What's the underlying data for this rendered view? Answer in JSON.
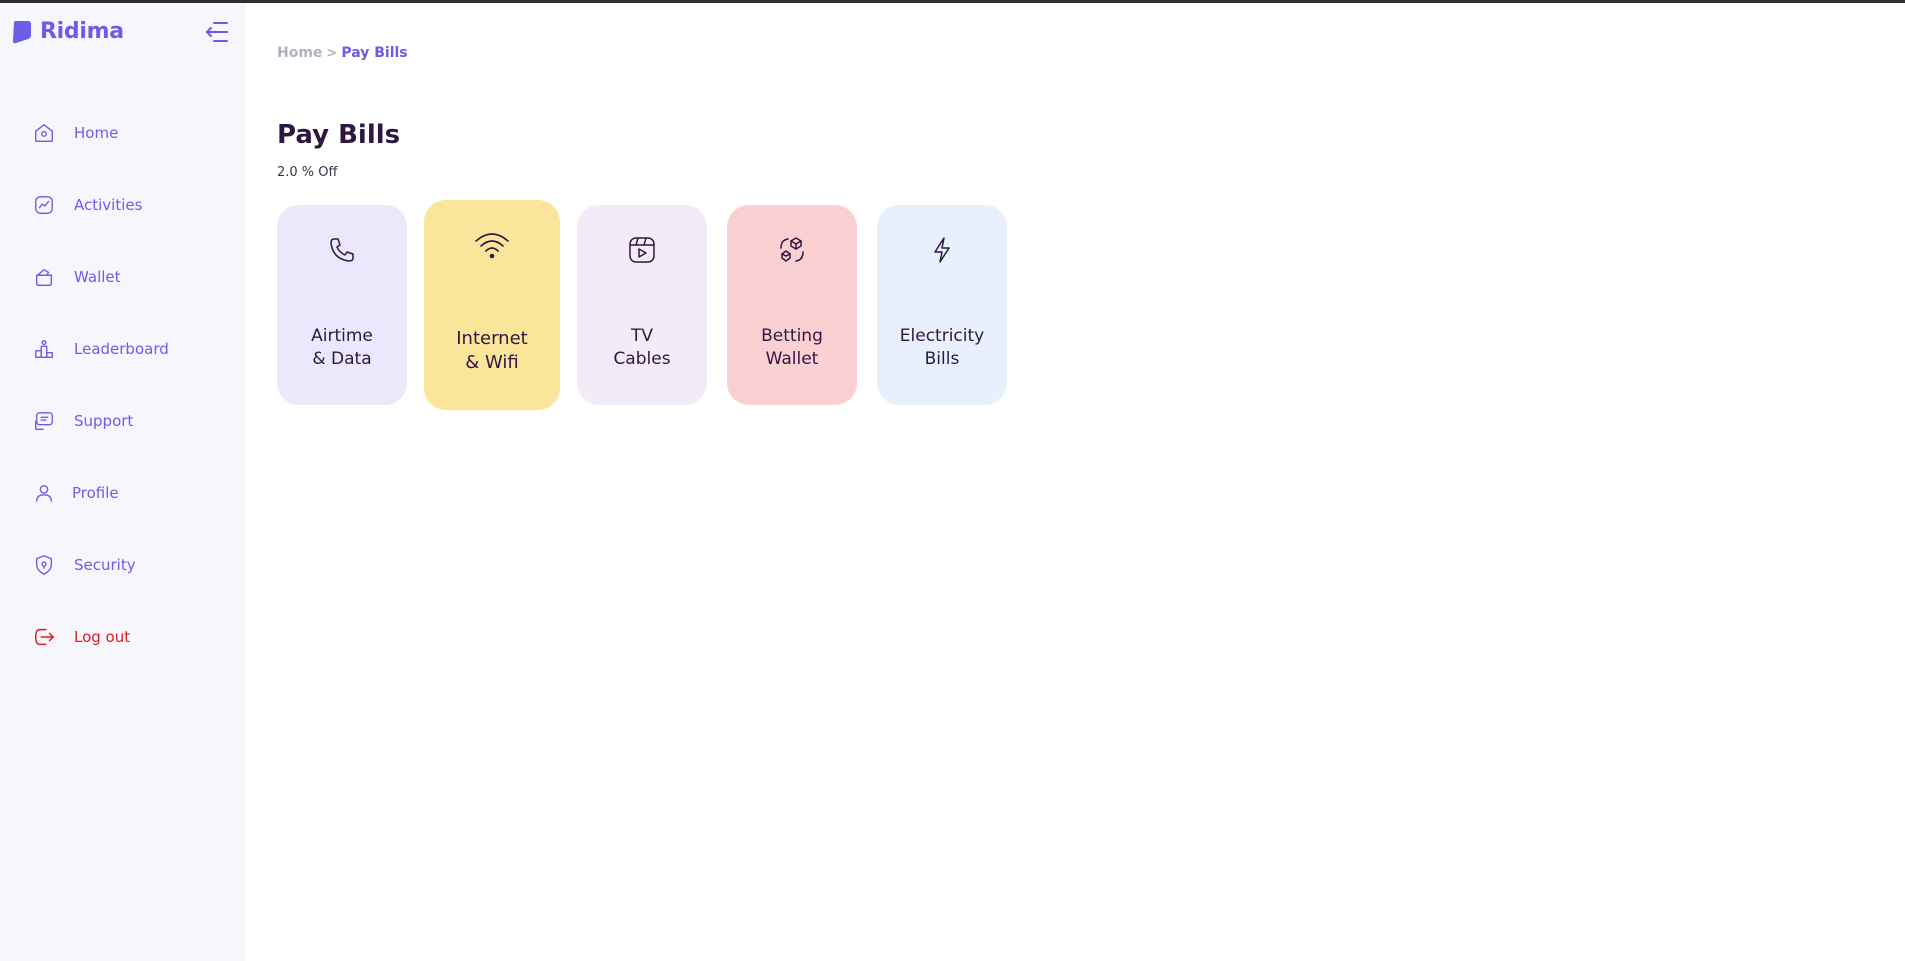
{
  "app": {
    "brand": "Ridima"
  },
  "sidebar": {
    "items": [
      {
        "label": "Home",
        "icon": "home-icon"
      },
      {
        "label": "Activities",
        "icon": "activity-chart-icon"
      },
      {
        "label": "Wallet",
        "icon": "wallet-icon"
      },
      {
        "label": "Leaderboard",
        "icon": "leaderboard-icon"
      },
      {
        "label": "Support",
        "icon": "support-icon"
      },
      {
        "label": "Profile",
        "icon": "user-icon"
      },
      {
        "label": "Security",
        "icon": "shield-icon"
      },
      {
        "label": "Log out",
        "icon": "logout-icon"
      }
    ]
  },
  "breadcrumb": {
    "home": "Home",
    "separator": ">",
    "current": "Pay Bills"
  },
  "page": {
    "title": "Pay Bills",
    "discount": "2.0 % Off"
  },
  "bills": [
    {
      "label": "Airtime\n& Data",
      "icon": "phone-icon",
      "color": "#ebe8fb"
    },
    {
      "label": "Internet\n& Wifi",
      "icon": "wifi-icon",
      "color": "#fae59b"
    },
    {
      "label": "TV\nCables",
      "icon": "tv-play-icon",
      "color": "#f3ecf8"
    },
    {
      "label": "Betting\nWallet",
      "icon": "dice-icon",
      "color": "#fbd0d2"
    },
    {
      "label": "Electricity\nBills",
      "icon": "lightning-icon",
      "color": "#e8f0fd"
    }
  ],
  "colors": {
    "accent": "#6c5ce7",
    "title": "#2e1842",
    "logout": "#d91c1c",
    "sidebar_bg": "#f7f6fd"
  }
}
